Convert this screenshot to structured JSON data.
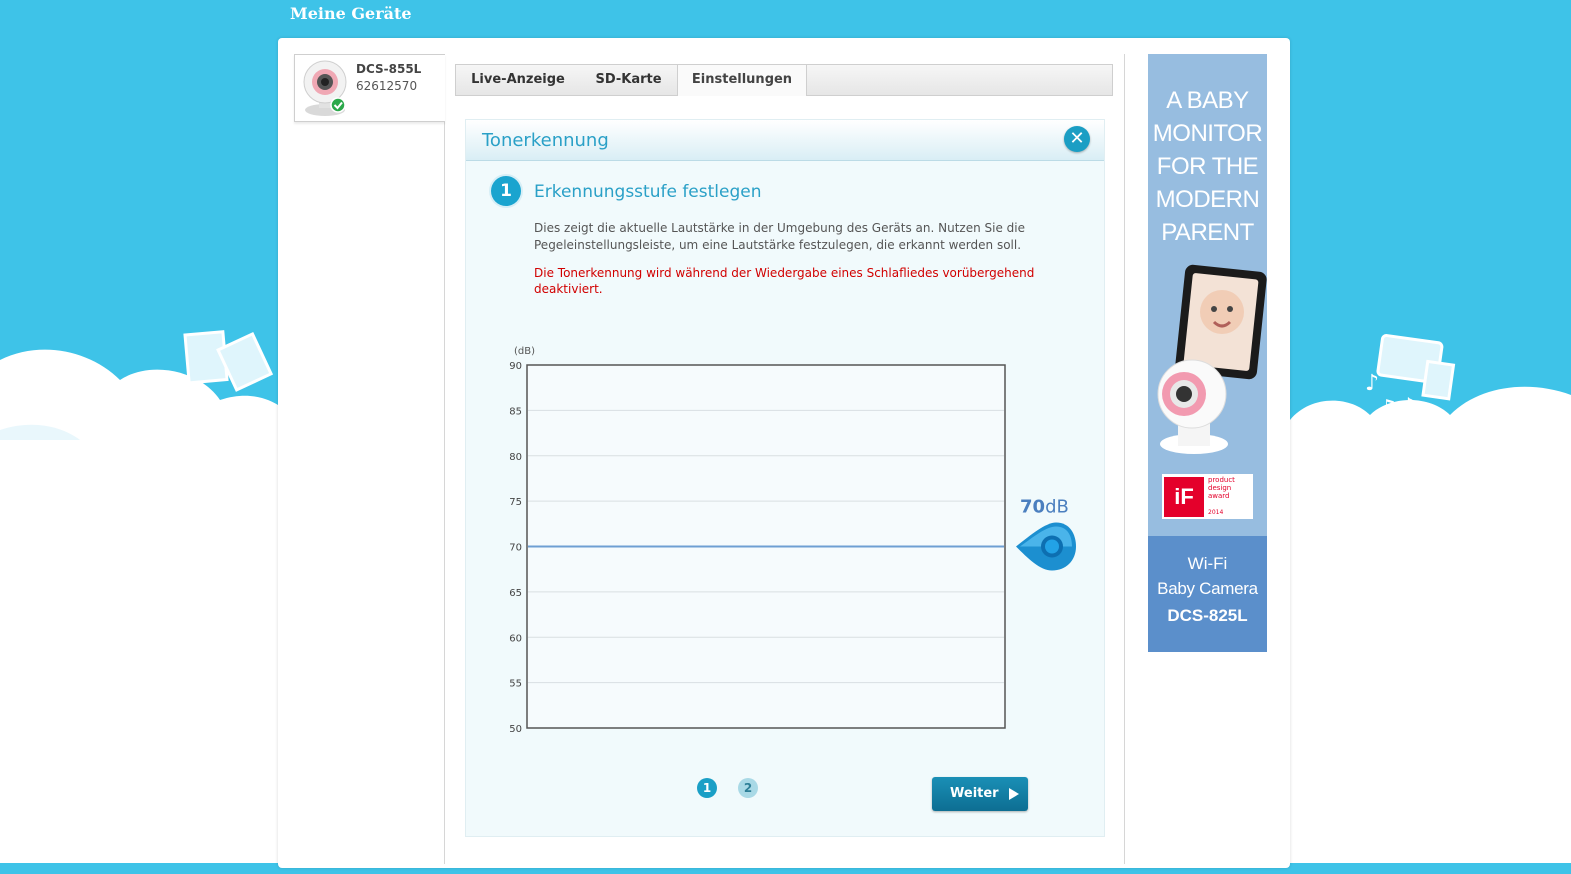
{
  "header": {
    "title": "Meine Geräte"
  },
  "device": {
    "name": "DCS-855L",
    "serial": "62612570"
  },
  "tabs": [
    {
      "label": "Live-Anzeige"
    },
    {
      "label": "SD-Karte"
    },
    {
      "label": "Einstellungen"
    }
  ],
  "dialog": {
    "title": "Tonerkennung",
    "step_number": "1",
    "step_title": "Erkennungsstufe festlegen",
    "description": "Dies zeigt die aktuelle Lautstärke in der Umgebung des Geräts an. Nutzen Sie die Pegeleinstellungsleiste, um eine Lautstärke festzulegen, die erkannt werden soll.",
    "warning": "Die Tonerkennung wird während der Wiedergabe eines Schlafliedes vorübergehend deaktiviert.",
    "pages": [
      "1",
      "2"
    ],
    "next_label": "Weiter"
  },
  "chart_data": {
    "type": "line",
    "unit_label": "(dB)",
    "yticks": [
      90,
      85,
      80,
      75,
      70,
      65,
      60,
      55,
      50
    ],
    "ylim": [
      50,
      90
    ],
    "threshold": 70,
    "threshold_number": "70",
    "threshold_unit": "dB",
    "grid": true
  },
  "ad": {
    "headline_lines": [
      "A BABY",
      "MONITOR",
      "FOR THE",
      "MODERN",
      "PARENT"
    ],
    "award_logo": "iF",
    "award_text": [
      "product",
      "design award"
    ],
    "award_year": "2014",
    "line1": "Wi-Fi",
    "line2": "Baby Camera",
    "model": "DCS-825L"
  },
  "colors": {
    "background": "#3ec3e8",
    "accent": "#1a9fc6",
    "warning": "#d10000",
    "threshold_line": "#6e9fd3"
  }
}
